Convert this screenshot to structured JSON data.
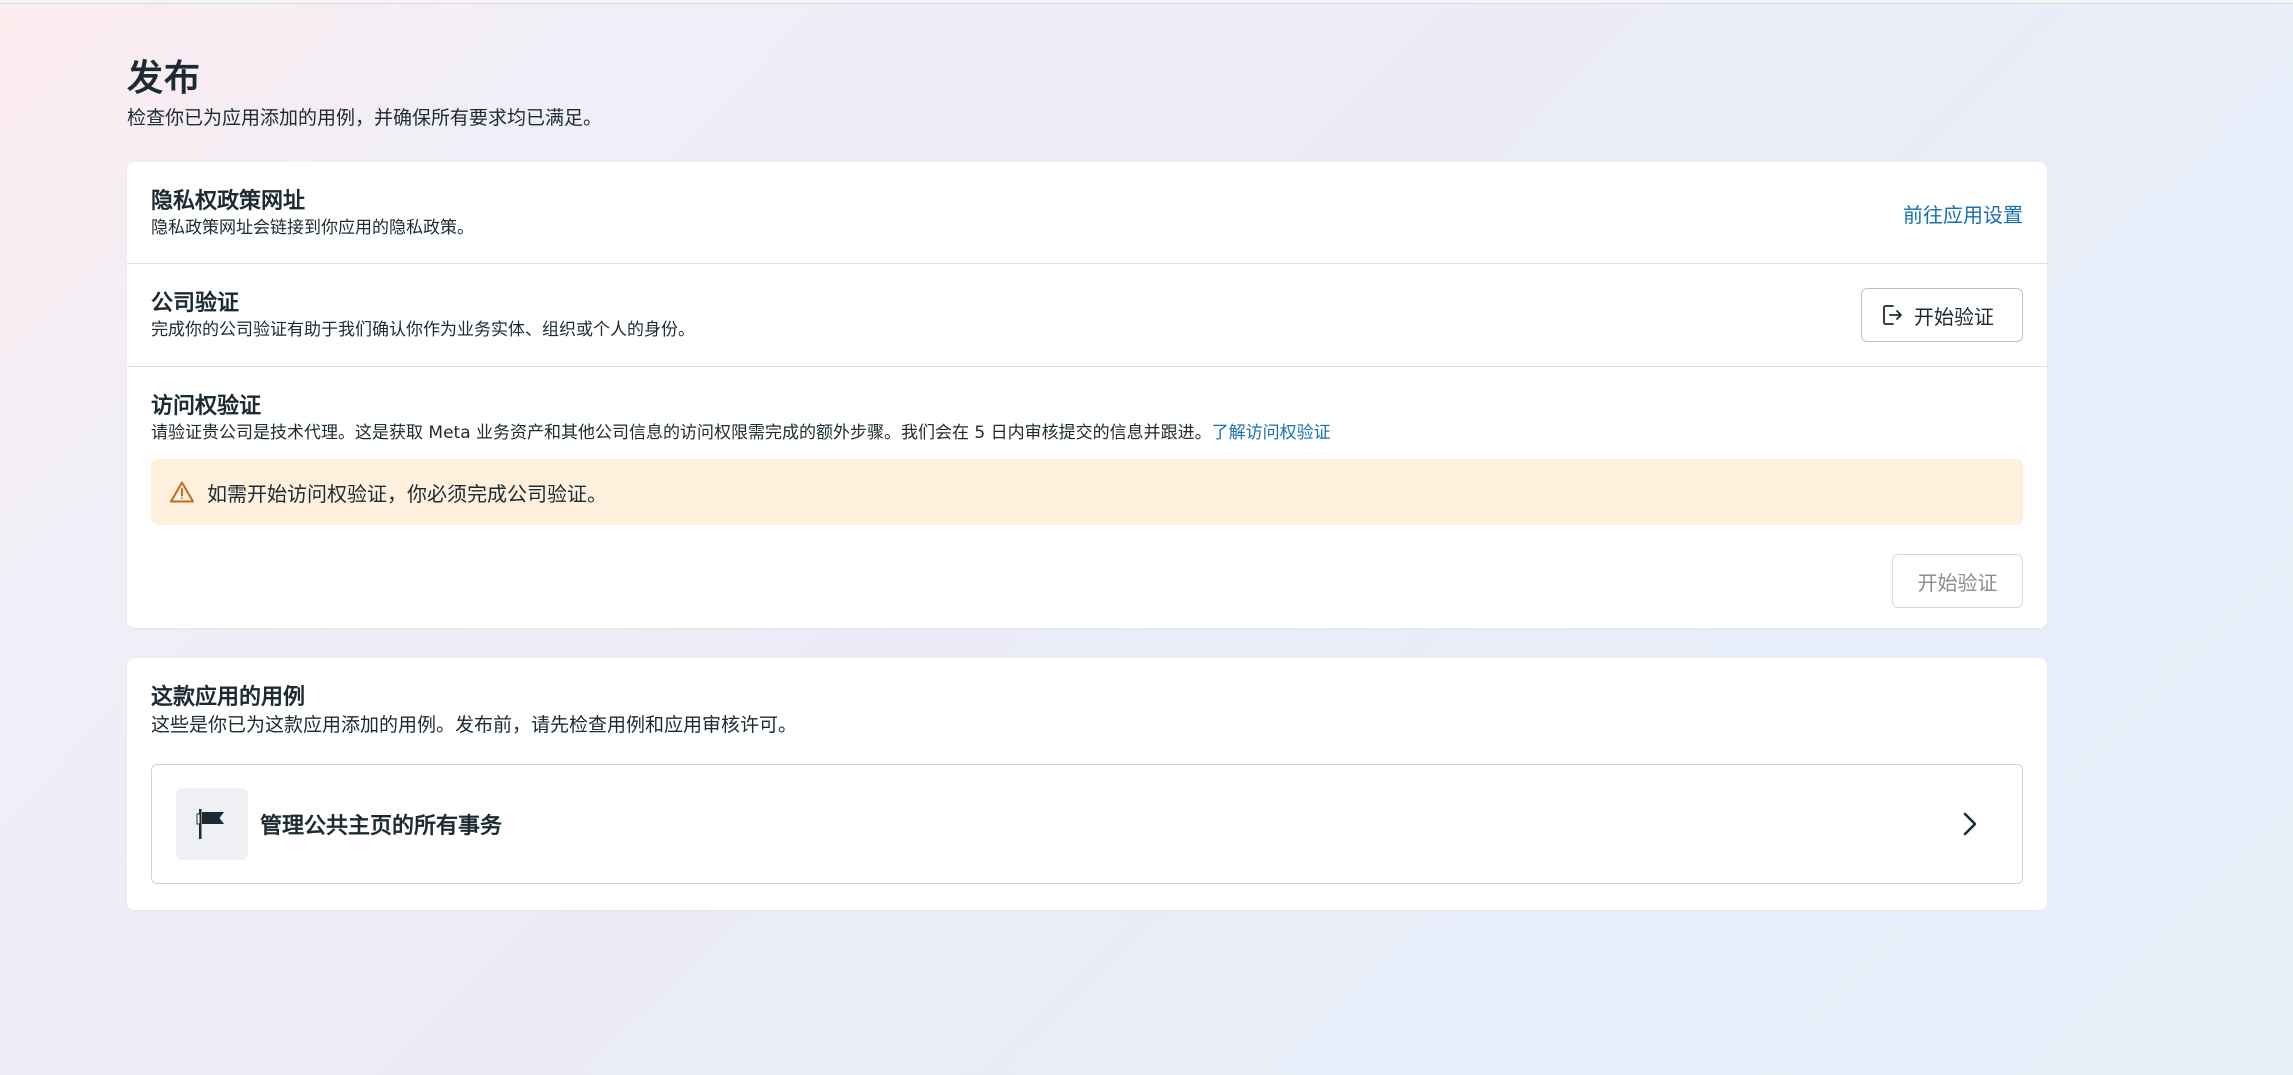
{
  "page": {
    "title": "发布",
    "subtitle": "检查你已为应用添加的用例，并确保所有要求均已满足。"
  },
  "requirements": {
    "privacy": {
      "title": "隐私权政策网址",
      "desc": "隐私政策网址会链接到你应用的隐私政策。",
      "action_label": "前往应用设置"
    },
    "company": {
      "title": "公司验证",
      "desc": "完成你的公司验证有助于我们确认你作为业务实体、组织或个人的身份。",
      "button_label": "开始验证",
      "button_icon": "exit-icon"
    },
    "access": {
      "title": "访问权验证",
      "desc": "请验证贵公司是技术代理。这是获取 Meta 业务资产和其他公司信息的访问权限需完成的额外步骤。我们会在 5 日内审核提交的信息并跟进。",
      "learn_more": "了解访问权验证",
      "alert_text": "如需开始访问权验证，你必须完成公司验证。",
      "alert_icon": "warning-icon",
      "button_label": "开始验证"
    }
  },
  "use_cases": {
    "title": "这款应用的用例",
    "desc": "这些是你已为这款应用添加的用例。发布前，请先检查用例和应用审核许可。",
    "items": [
      {
        "label": "管理公共主页的所有事务",
        "icon": "flag-icon"
      }
    ]
  },
  "colors": {
    "link": "#1a6fb3",
    "alert_bg": "#fff0de",
    "warning": "#c46a16",
    "text": "#1c2b33"
  }
}
